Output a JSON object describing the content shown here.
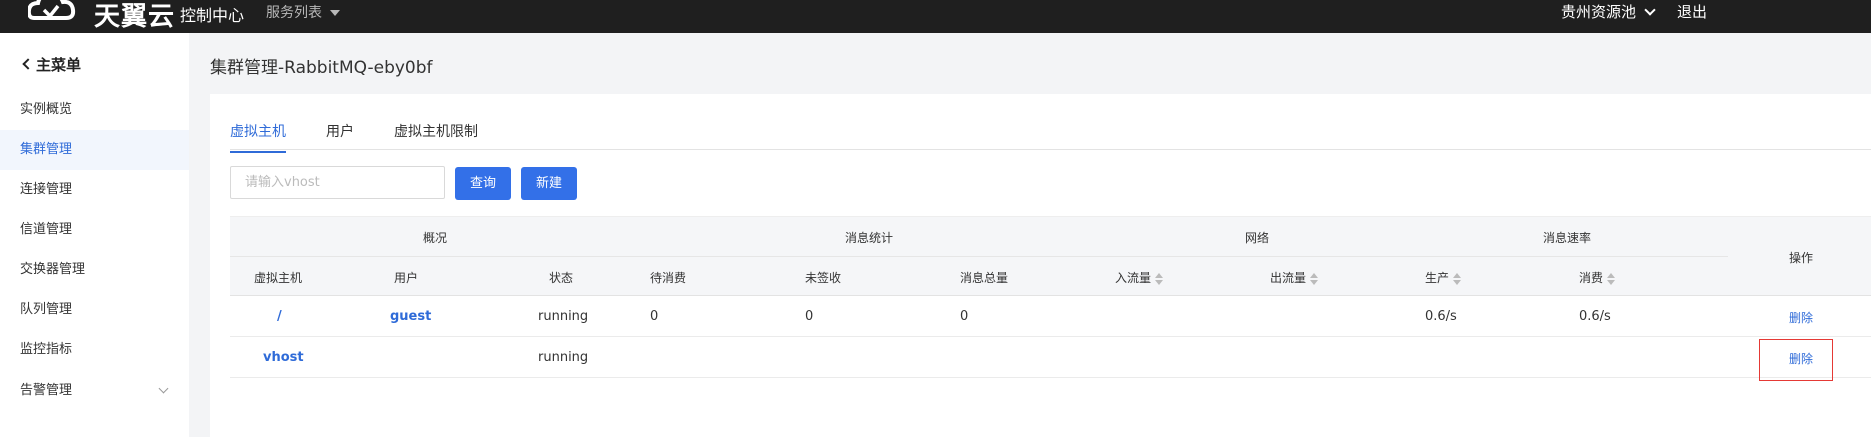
{
  "header": {
    "brand": "天翼云",
    "console": "控制中心",
    "services": "服务列表",
    "region": "贵州资源池",
    "logout": "退出"
  },
  "sidebar": {
    "back": "主菜单",
    "items": [
      {
        "label": "实例概览"
      },
      {
        "label": "集群管理"
      },
      {
        "label": "连接管理"
      },
      {
        "label": "信道管理"
      },
      {
        "label": "交换器管理"
      },
      {
        "label": "队列管理"
      },
      {
        "label": "监控指标"
      },
      {
        "label": "告警管理"
      }
    ]
  },
  "page": {
    "title": "集群管理-RabbitMQ-eby0bf"
  },
  "tabs": [
    {
      "label": "虚拟主机"
    },
    {
      "label": "用户"
    },
    {
      "label": "虚拟主机限制"
    }
  ],
  "toolbar": {
    "search_placeholder": "请输入vhost",
    "search_value": "",
    "query_label": "查询",
    "new_label": "新建"
  },
  "table": {
    "groups": [
      "概况",
      "消息统计",
      "网络",
      "消息速率"
    ],
    "action_header": "操作",
    "columns": [
      "虚拟主机",
      "用户",
      "状态",
      "待消费",
      "未签收",
      "消息总量",
      "入流量",
      "出流量",
      "生产",
      "消费"
    ],
    "rows": [
      {
        "vhost": "/",
        "user": "guest",
        "status": "running",
        "pending": "0",
        "unacked": "0",
        "total": "0",
        "in": "",
        "out": "",
        "produce": "0.6/s",
        "consume": "0.6/s",
        "action": "删除"
      },
      {
        "vhost": "vhost",
        "user": "",
        "status": "running",
        "pending": "",
        "unacked": "",
        "total": "",
        "in": "",
        "out": "",
        "produce": "",
        "consume": "",
        "action": "删除"
      }
    ]
  },
  "colors": {
    "accent": "#3370e8",
    "link": "#2f6bd8",
    "highlight": "#e53935"
  }
}
